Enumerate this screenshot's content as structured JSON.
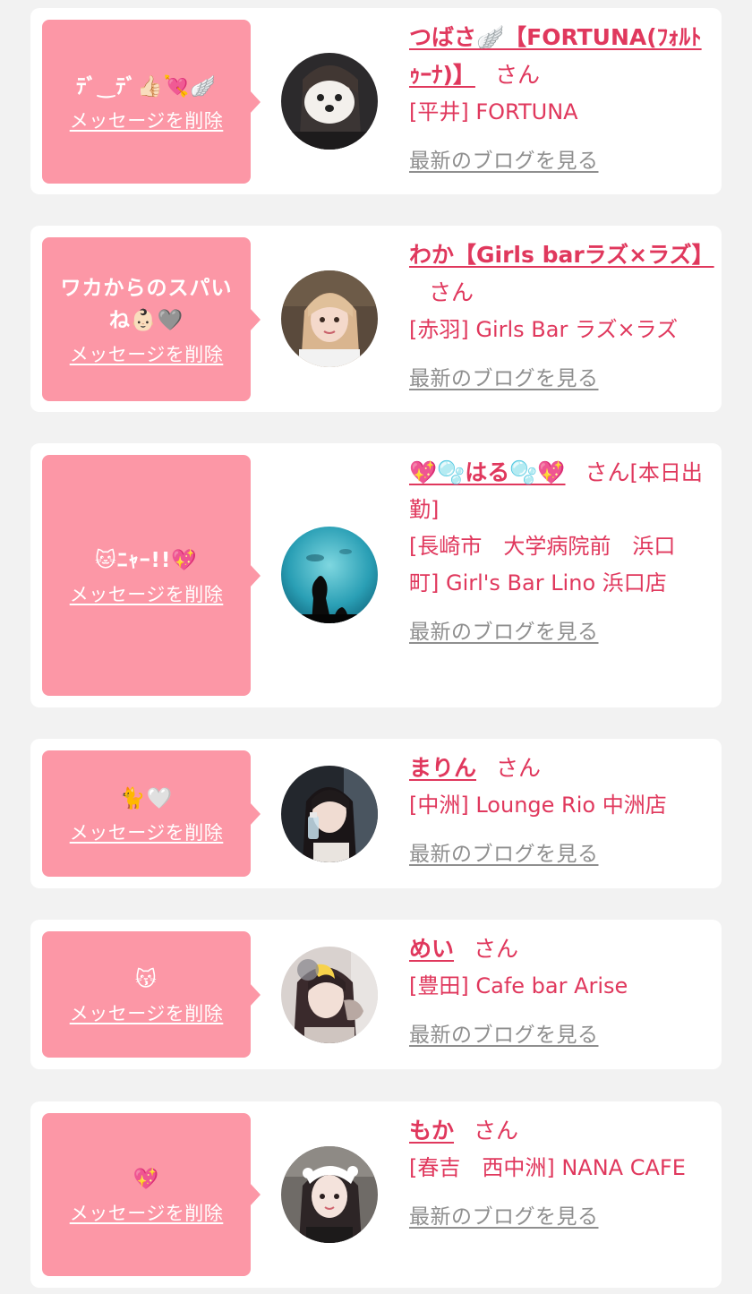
{
  "delete_label": "メッセージを削除",
  "blog_label": "最新のブログを見る",
  "honorific": "さん",
  "messages": [
    {
      "bubble_text": "ﾃﾞ‿ﾃﾞ👍🏻💘🪽",
      "name": "つばさ🪽【FORTUNA(ﾌｫﾙﾄｩｰﾅ)】",
      "suffix": "",
      "shop": "[平井] FORTUNA",
      "avatar_icon": "avatar-photo-dog-filter-icon"
    },
    {
      "bubble_text": "ワカからのスパいね👶🏻🩶",
      "name": "わか【Girls barラズ×ラズ】",
      "suffix": "",
      "shop": "[赤羽] Girls Bar ラズ×ラズ",
      "avatar_icon": "avatar-photo-blonde-icon"
    },
    {
      "bubble_text": "🐱ﾆｬｰ!!💖",
      "name": "💖🫧はる🫧💖",
      "suffix": "[本日出勤]",
      "shop": "[長崎市　大学病院前　浜口町] Girl's Bar Lino 浜口店",
      "avatar_icon": "avatar-photo-aquarium-icon"
    },
    {
      "bubble_text": "🐈🤍",
      "name": "まりん",
      "suffix": "",
      "shop": "[中洲] Lounge Rio 中洲店",
      "avatar_icon": "avatar-photo-drink-icon"
    },
    {
      "bubble_text": "😽",
      "name": "めい",
      "suffix": "",
      "shop": "[豊田] Cafe bar Arise",
      "avatar_icon": "avatar-photo-moon-sticker-icon"
    },
    {
      "bubble_text": "💖",
      "name": "もか",
      "suffix": "",
      "shop": "[春吉　西中洲] NANA CAFE",
      "avatar_icon": "avatar-photo-headband-icon"
    }
  ]
}
